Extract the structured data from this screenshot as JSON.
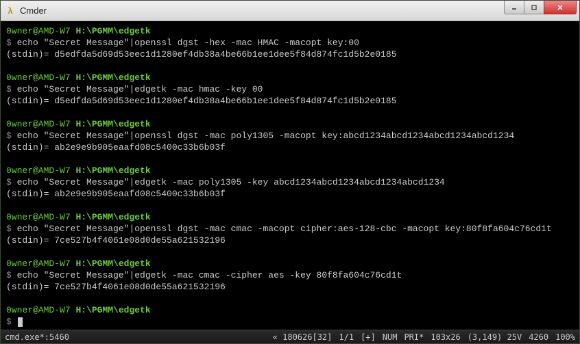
{
  "window": {
    "title": "Cmder",
    "icon_label": "λ"
  },
  "blocks": [
    {
      "user": "0wner@AMD-W7",
      "path": "H:\\PGMM\\edgetk",
      "cmd": "echo \"Secret Message\"|openssl dgst -hex -mac HMAC -macopt key:00",
      "out": "(stdin)= d5edfda5d69d53eec1d1280ef4db38a4be66b1ee1dee5f84d874fc1d5b2e0185"
    },
    {
      "user": "0wner@AMD-W7",
      "path": "H:\\PGMM\\edgetk",
      "cmd": "echo \"Secret Message\"|edgetk -mac hmac -key 00",
      "out": "(stdin)= d5edfda5d69d53eec1d1280ef4db38a4be66b1ee1dee5f84d874fc1d5b2e0185"
    },
    {
      "user": "0wner@AMD-W7",
      "path": "H:\\PGMM\\edgetk",
      "cmd": "echo \"Secret Message\"|openssl dgst -mac poly1305 -macopt key:abcd1234abcd1234abcd1234abcd1234",
      "out": "(stdin)= ab2e9e9b905eaafd08c5400c33b6b03f"
    },
    {
      "user": "0wner@AMD-W7",
      "path": "H:\\PGMM\\edgetk",
      "cmd": "echo \"Secret Message\"|edgetk -mac poly1305 -key abcd1234abcd1234abcd1234abcd1234",
      "out": "(stdin)= ab2e9e9b905eaafd08c5400c33b6b03f"
    },
    {
      "user": "0wner@AMD-W7",
      "path": "H:\\PGMM\\edgetk",
      "cmd": "echo \"Secret Message\"|openssl dgst -mac cmac -macopt cipher:aes-128-cbc -macopt key:80f8fa604c76cd1t",
      "out": "(stdin)= 7ce527b4f4061e08d0de55a621532196"
    },
    {
      "user": "0wner@AMD-W7",
      "path": "H:\\PGMM\\edgetk",
      "cmd": "echo \"Secret Message\"|edgetk -mac cmac -cipher aes -key 80f8fa604c76cd1t",
      "out": "(stdin)= 7ce527b4f4061e08d0de55a621532196"
    }
  ],
  "final_prompt": {
    "user": "0wner@AMD-W7",
    "path": "H:\\PGMM\\edgetk"
  },
  "status": {
    "left": "cmd.exe*:5460",
    "items": [
      "« 180626[32]",
      "1/1",
      "[+]",
      "NUM",
      "PRI*",
      "103x26",
      "(3,149) 25V",
      "4260",
      "100%"
    ]
  }
}
